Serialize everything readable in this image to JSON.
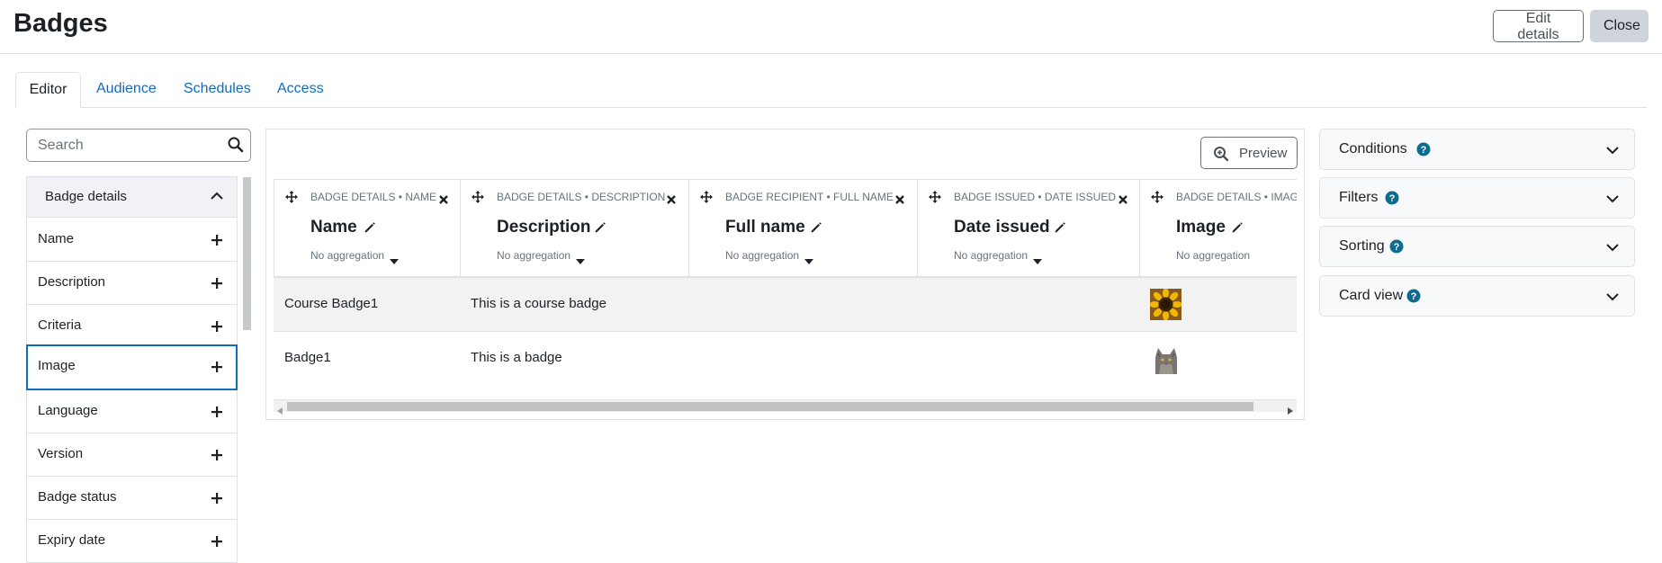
{
  "page": {
    "title": "Badges",
    "edit_details_label": "Edit details",
    "close_label": "Close"
  },
  "tabs": [
    {
      "label": "Editor",
      "active": true
    },
    {
      "label": "Audience",
      "active": false
    },
    {
      "label": "Schedules",
      "active": false
    },
    {
      "label": "Access",
      "active": false
    }
  ],
  "sidebar": {
    "search_placeholder": "Search",
    "section_title": "Badge details",
    "items": [
      {
        "label": "Name"
      },
      {
        "label": "Description"
      },
      {
        "label": "Criteria"
      },
      {
        "label": "Image"
      },
      {
        "label": "Language"
      },
      {
        "label": "Version"
      },
      {
        "label": "Badge status"
      },
      {
        "label": "Expiry date"
      }
    ]
  },
  "report": {
    "preview_label": "Preview",
    "columns": [
      {
        "source": "BADGE DETAILS • NAME",
        "title": "Name",
        "aggregation": "No aggregation"
      },
      {
        "source": "BADGE DETAILS • DESCRIPTION",
        "title": "Description",
        "aggregation": "No aggregation"
      },
      {
        "source": "BADGE RECIPIENT • FULL NAME",
        "title": "Full name",
        "aggregation": "No aggregation"
      },
      {
        "source": "BADGE ISSUED • DATE ISSUED",
        "title": "Date issued",
        "aggregation": "No aggregation"
      },
      {
        "source": "BADGE DETAILS • IMAG",
        "title": "Image",
        "aggregation": "No aggregation"
      }
    ],
    "rows": [
      {
        "name": "Course Badge1",
        "description": "This is a course badge",
        "full_name": "",
        "date_issued": "",
        "image": "sunflower-image"
      },
      {
        "name": "Badge1",
        "description": "This is a badge",
        "full_name": "",
        "date_issued": "",
        "image": "cat-image"
      }
    ]
  },
  "panels": [
    {
      "label": "Conditions"
    },
    {
      "label": "Filters"
    },
    {
      "label": "Sorting"
    },
    {
      "label": "Card view"
    }
  ],
  "colors": {
    "link": "#0f6cbf",
    "help_icon": "#0f6b8e",
    "focus_border": "#0f6cbf"
  }
}
